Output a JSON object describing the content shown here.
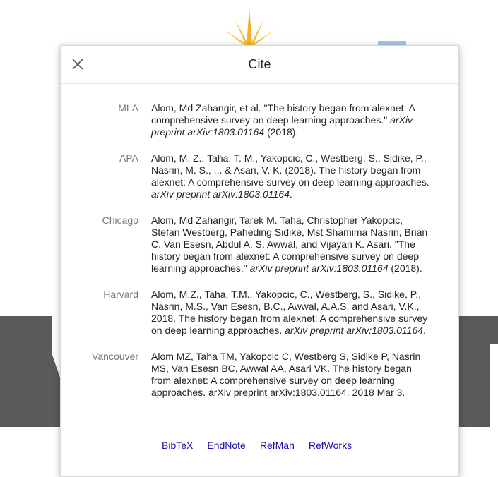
{
  "dialog": {
    "title": "Cite",
    "close_icon": "close-icon"
  },
  "citations": [
    {
      "style": "MLA",
      "before": "Alom, Md Zahangir, et al. \"The history began from alexnet: A comprehensive survey on deep learning approaches.\" ",
      "italic": "arXiv preprint arXiv:1803.01164",
      "after": " (2018)."
    },
    {
      "style": "APA",
      "before": "Alom, M. Z., Taha, T. M., Yakopcic, C., Westberg, S., Sidike, P., Nasrin, M. S., ... & Asari, V. K. (2018). The history began from alexnet: A comprehensive survey on deep learning approaches. ",
      "italic": "arXiv preprint arXiv:1803.01164",
      "after": "."
    },
    {
      "style": "Chicago",
      "before": "Alom, Md Zahangir, Tarek M. Taha, Christopher Yakopcic, Stefan Westberg, Paheding Sidike, Mst Shamima Nasrin, Brian C. Van Esesn, Abdul A. S. Awwal, and Vijayan K. Asari. \"The history began from alexnet: A comprehensive survey on deep learning approaches.\" ",
      "italic": "arXiv preprint arXiv:1803.01164",
      "after": " (2018)."
    },
    {
      "style": "Harvard",
      "before": "Alom, M.Z., Taha, T.M., Yakopcic, C., Westberg, S., Sidike, P., Nasrin, M.S., Van Esesn, B.C., Awwal, A.A.S. and Asari, V.K., 2018. The history began from alexnet: A comprehensive survey on deep learning approaches. ",
      "italic": "arXiv preprint arXiv:1803.01164",
      "after": "."
    },
    {
      "style": "Vancouver",
      "before": "Alom MZ, Taha TM, Yakopcic C, Westberg S, Sidike P, Nasrin MS, Van Esesn BC, Awwal AA, Asari VK. The history began from alexnet: A comprehensive survey on deep learning approaches. arXiv preprint arXiv:1803.01164. 2018 Mar 3.",
      "italic": "",
      "after": ""
    }
  ],
  "export_links": [
    "BibTeX",
    "EndNote",
    "RefMan",
    "RefWorks"
  ],
  "colors": {
    "link": "#1a0dab",
    "label": "#777777",
    "text": "#222222",
    "background_logo_gray": "#5a5a5a",
    "background_sun": "#f6b21b"
  }
}
